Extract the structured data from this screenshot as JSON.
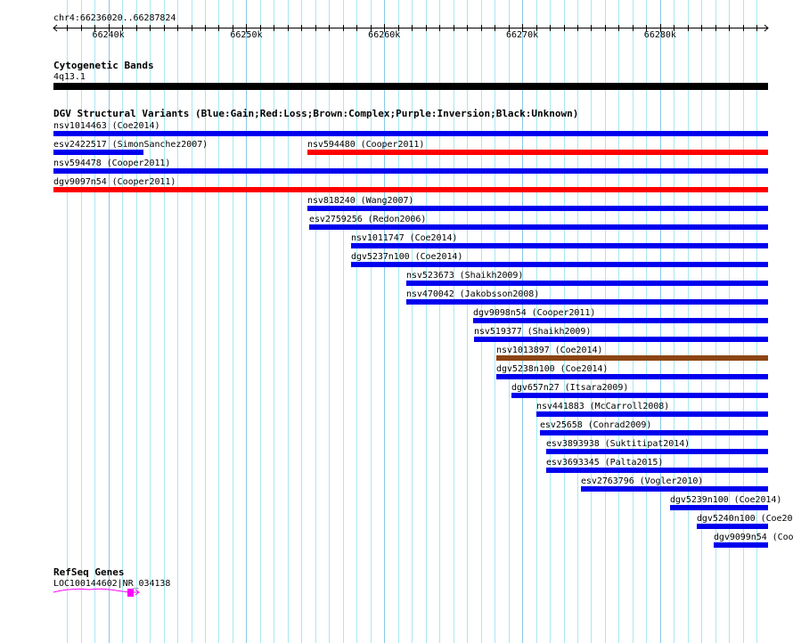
{
  "ruler": {
    "region_label": "chr4:66236020..66287824",
    "start": 66236020,
    "end": 66287824,
    "tick_labels": [
      "66240k",
      "66250k",
      "66260k",
      "66270k",
      "66280k"
    ],
    "tick_values": [
      66240000,
      66250000,
      66260000,
      66270000,
      66280000
    ]
  },
  "cytoband": {
    "title": "Cytogenetic Bands",
    "band": "4q13.1",
    "color": "#000000"
  },
  "dgv": {
    "title": "DGV Structural Variants (Blue:Gain;Red:Loss;Brown:Complex;Purple:Inversion;Black:Unknown)",
    "colors": {
      "gain": "#0000ee",
      "loss": "#ff0000",
      "complex": "#8b4513",
      "inversion": "#800080",
      "unknown": "#000000"
    },
    "rows": [
      [
        {
          "label": "nsv1014463 (Coe2014)",
          "type": "gain",
          "start": 66236020,
          "end": 66287824
        }
      ],
      [
        {
          "label": "esv2422517 (SimonSanchez2007)",
          "type": "gain",
          "start": 66236020,
          "end": 66242544
        },
        {
          "label": "nsv594480 (Cooper2011)",
          "type": "loss",
          "start": 66254428,
          "end": 66287824
        }
      ],
      [
        {
          "label": "nsv594478 (Cooper2011)",
          "type": "gain",
          "start": 66236020,
          "end": 66287824
        }
      ],
      [
        {
          "label": "dgv9097n54 (Cooper2011)",
          "type": "loss",
          "start": 66236020,
          "end": 66287824
        }
      ],
      [
        {
          "label": "nsv818240 (Wang2007)",
          "type": "gain",
          "start": 66254428,
          "end": 66287824
        }
      ],
      [
        {
          "label": "esv2759256 (Redon2006)",
          "type": "gain",
          "start": 66254557,
          "end": 66287824
        }
      ],
      [
        {
          "label": "nsv1011747 (Coe2014)",
          "type": "gain",
          "start": 66257593,
          "end": 66287824
        }
      ],
      [
        {
          "label": "dgv5237n100 (Coe2014)",
          "type": "gain",
          "start": 66257593,
          "end": 66287824
        }
      ],
      [
        {
          "label": "nsv523673 (Shaikh2009)",
          "type": "gain",
          "start": 66261598,
          "end": 66287824
        }
      ],
      [
        {
          "label": "nsv470042 (Jakobsson2008)",
          "type": "gain",
          "start": 66261598,
          "end": 66287824
        }
      ],
      [
        {
          "label": "dgv9098n54 (Cooper2011)",
          "type": "gain",
          "start": 66266442,
          "end": 66287824
        }
      ],
      [
        {
          "label": "nsv519377 (Shaikh2009)",
          "type": "gain",
          "start": 66266507,
          "end": 66287824
        }
      ],
      [
        {
          "label": "nsv1013897 (Coe2014)",
          "type": "complex",
          "start": 66268121,
          "end": 66287824
        }
      ],
      [
        {
          "label": "dgv5238n100 (Coe2014)",
          "type": "gain",
          "start": 66268121,
          "end": 66287824
        }
      ],
      [
        {
          "label": "dgv657n27 (Itsara2009)",
          "type": "gain",
          "start": 66269219,
          "end": 66287824
        }
      ],
      [
        {
          "label": "nsv441883 (McCarroll2008)",
          "type": "gain",
          "start": 66271028,
          "end": 66287824
        }
      ],
      [
        {
          "label": "esv25658 (Conrad2009)",
          "type": "gain",
          "start": 66271286,
          "end": 66287824
        }
      ],
      [
        {
          "label": "esv3893938 (Suktitipat2014)",
          "type": "gain",
          "start": 66271738,
          "end": 66287824
        }
      ],
      [
        {
          "label": "esv3693345 (Palta2015)",
          "type": "gain",
          "start": 66271738,
          "end": 66287824
        }
      ],
      [
        {
          "label": "esv2763796 (Vogler2010)",
          "type": "gain",
          "start": 66274257,
          "end": 66287824
        }
      ],
      [
        {
          "label": "dgv5239n100 (Coe2014)",
          "type": "gain",
          "start": 66280716,
          "end": 66287824
        }
      ],
      [
        {
          "label": "dgv5240n100 (Coe20",
          "type": "gain",
          "start": 66282654,
          "end": 66287824
        }
      ],
      [
        {
          "label": "dgv9099n54 (Coo",
          "type": "gain",
          "start": 66283881,
          "end": 66287824
        }
      ]
    ]
  },
  "refseq": {
    "title": "RefSeq Genes",
    "gene_label": "LOC100144602|NR_034138",
    "color": "#ff00ff"
  }
}
